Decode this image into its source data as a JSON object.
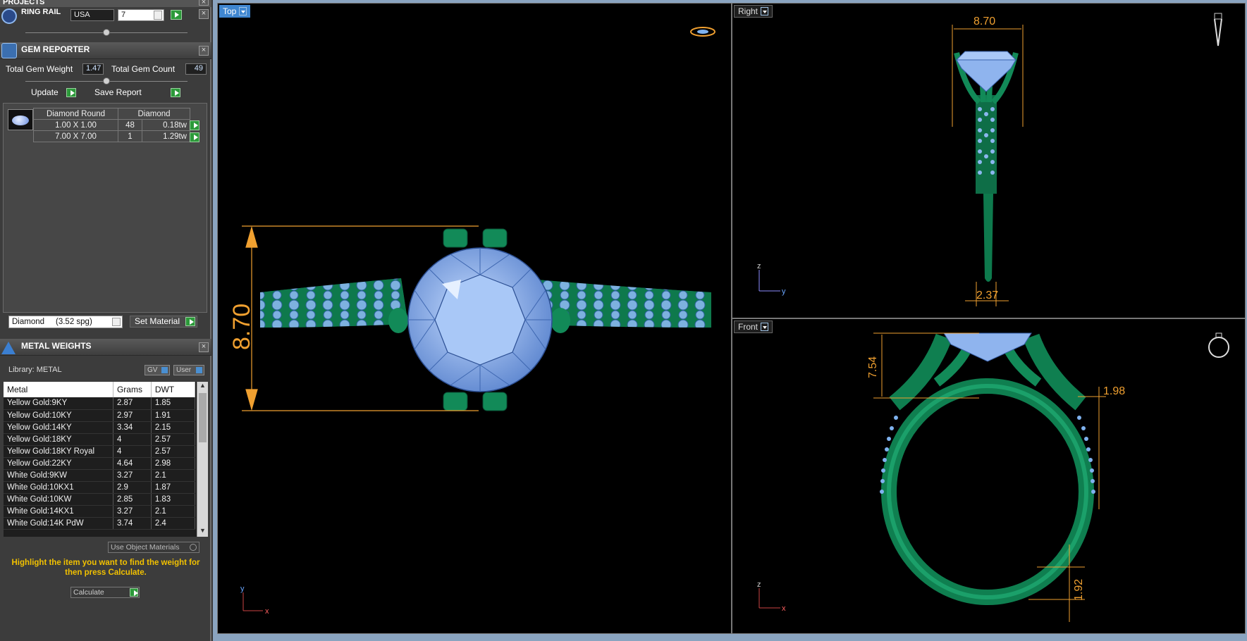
{
  "projects": {
    "title": "PROJECTS"
  },
  "ring_rail": {
    "label": "RING RAIL",
    "country": "USA",
    "size": "7"
  },
  "gem_reporter": {
    "title": "GEM REPORTER",
    "total_weight_label": "Total Gem Weight",
    "total_weight_value": "1.47",
    "total_count_label": "Total Gem Count",
    "total_count_value": "49",
    "update_label": "Update",
    "save_report_label": "Save Report",
    "header": [
      "Diamond Round",
      "Diamond"
    ],
    "rows": [
      {
        "size": "1.00 X 1.00",
        "count": "48",
        "weight": "0.18tw"
      },
      {
        "size": "7.00 X 7.00",
        "count": "1",
        "weight": "1.29tw"
      }
    ],
    "material_select": "Diamond     (3.52 spg)",
    "set_material_label": "Set Material"
  },
  "metal_weights": {
    "title": "METAL WEIGHTS",
    "library_label": "Library: METAL",
    "gv_label": "GV",
    "user_label": "User",
    "columns": [
      "Metal",
      "Grams",
      "DWT"
    ],
    "rows": [
      [
        "Yellow Gold:9KY",
        "2.87",
        "1.85"
      ],
      [
        "Yellow Gold:10KY",
        "2.97",
        "1.91"
      ],
      [
        "Yellow Gold:14KY",
        "3.34",
        "2.15"
      ],
      [
        "Yellow Gold:18KY",
        "4",
        "2.57"
      ],
      [
        "Yellow Gold:18KY Royal",
        "4",
        "2.57"
      ],
      [
        "Yellow Gold:22KY",
        "4.64",
        "2.98"
      ],
      [
        "White Gold:9KW",
        "3.27",
        "2.1"
      ],
      [
        "White Gold:10KX1",
        "2.9",
        "1.87"
      ],
      [
        "White Gold:10KW",
        "2.85",
        "1.83"
      ],
      [
        "White Gold:14KX1",
        "3.27",
        "2.1"
      ],
      [
        "White Gold:14K PdW",
        "3.74",
        "2.4"
      ]
    ],
    "use_object_materials_label": "Use Object Materials",
    "hint": "Highlight the item you want to find the weight for then press Calculate.",
    "calculate_label": "Calculate"
  },
  "viewports": {
    "top": {
      "label": "Top",
      "dimension": "8.70",
      "axis_y": "y",
      "axis_x": "x"
    },
    "right": {
      "label": "Right",
      "dim_top": "8.70",
      "dim_bottom": "2.37",
      "axis_z": "z",
      "axis_y": "y"
    },
    "front": {
      "label": "Front",
      "dim_left": "7.54",
      "dim_right": "1.98",
      "dim_bottom": "1.92",
      "axis_z": "z",
      "axis_x": "x"
    }
  },
  "colors": {
    "metal": "#0f8a5a",
    "gem": "#7fb2ef",
    "dimension": "#f0a030",
    "tab": "#4a8fd1",
    "hint": "#f2c100"
  }
}
